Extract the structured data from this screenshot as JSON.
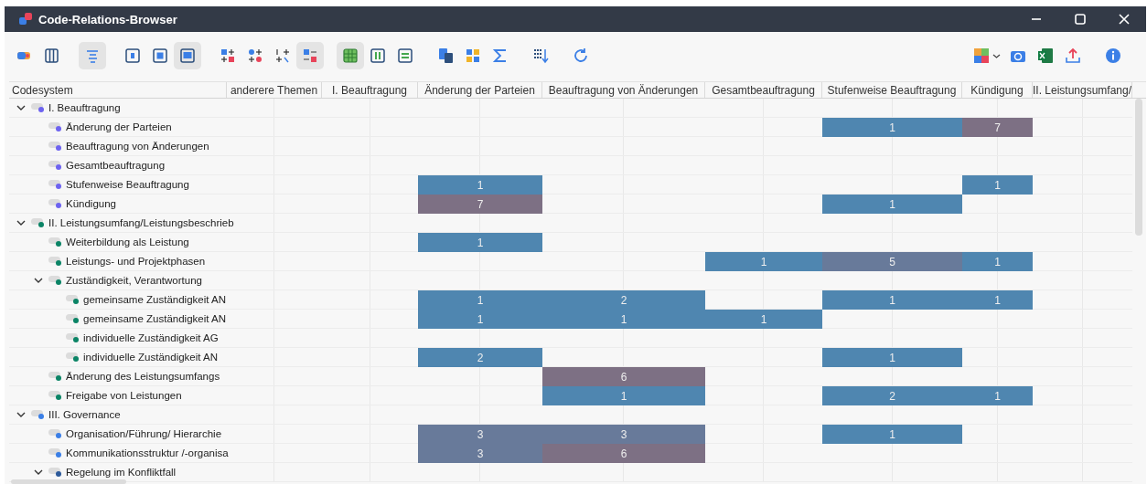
{
  "window": {
    "title": "Code-Relations-Browser"
  },
  "toolbar": {
    "left_groups": [
      {
        "items": [
          {
            "kind": "tag",
            "selected": false
          },
          {
            "kind": "columns",
            "selected": false
          }
        ]
      },
      {
        "items": [
          {
            "kind": "align",
            "selected": true
          }
        ]
      },
      {
        "items": [
          {
            "kind": "framesmall",
            "selected": false
          },
          {
            "kind": "framemid",
            "selected": false
          },
          {
            "kind": "framefull",
            "selected": true
          }
        ]
      },
      {
        "items": [
          {
            "kind": "squares",
            "selected": false
          },
          {
            "kind": "dots",
            "selected": false
          },
          {
            "kind": "numbers",
            "selected": false
          },
          {
            "kind": "mixed",
            "selected": true
          }
        ]
      },
      {
        "items": [
          {
            "kind": "table",
            "selected": true
          },
          {
            "kind": "pause",
            "selected": false
          },
          {
            "kind": "rows",
            "selected": false
          }
        ]
      },
      {
        "items": [
          {
            "kind": "docs",
            "selected": false
          },
          {
            "kind": "tiles",
            "selected": false
          },
          {
            "kind": "sigma",
            "selected": false
          }
        ]
      },
      {
        "items": [
          {
            "kind": "sort",
            "selected": false
          }
        ]
      },
      {
        "items": [
          {
            "kind": "refresh",
            "selected": false
          }
        ]
      }
    ],
    "right_items": [
      {
        "kind": "puzzle",
        "selected": false
      },
      {
        "kind": "camera",
        "selected": false
      },
      {
        "kind": "excel",
        "selected": false
      },
      {
        "kind": "export",
        "selected": false
      },
      {
        "kind": "info",
        "selected": false
      }
    ]
  },
  "table": {
    "columns": [
      "Codesystem",
      "anderere Themen",
      "I. Beauftragung",
      "Änderung der Parteien",
      "Beauftragung von Änderungen",
      "Gesamtbeauftragung",
      "Stufenweise Beauftragung",
      "Kündigung",
      "II. Leistungsumfang/"
    ],
    "rows": [
      {
        "label": "I. Beauftragung",
        "color": "#6d63f0",
        "expanded": true,
        "cells": [
          null,
          null,
          null,
          null,
          null,
          null,
          null,
          null
        ],
        "children": [
          {
            "label": "Änderung der Parteien",
            "color": "#6d63f0",
            "cells": [
              null,
              null,
              null,
              null,
              null,
              {
                "value": "1",
                "color": "#4f86b0"
              },
              {
                "value": "7",
                "color": "#7d7084"
              },
              null
            ]
          },
          {
            "label": "Beauftragung von Änderungen",
            "color": "#6d63f0",
            "cells": [
              null,
              null,
              null,
              null,
              null,
              null,
              null,
              null
            ]
          },
          {
            "label": "Gesamtbeauftragung",
            "color": "#6d63f0",
            "cells": [
              null,
              null,
              null,
              null,
              null,
              null,
              null,
              null
            ]
          },
          {
            "label": "Stufenweise Beauftragung",
            "color": "#6d63f0",
            "cells": [
              null,
              null,
              {
                "value": "1",
                "color": "#4f86b0"
              },
              null,
              null,
              null,
              {
                "value": "1",
                "color": "#4f86b0"
              },
              null
            ]
          },
          {
            "label": "Kündigung",
            "color": "#6d63f0",
            "cells": [
              null,
              null,
              {
                "value": "7",
                "color": "#7d7084"
              },
              null,
              null,
              {
                "value": "1",
                "color": "#4f86b0"
              },
              null,
              null
            ]
          }
        ]
      },
      {
        "label": "II. Leistungsumfang/Leistungsbeschrieb",
        "color": "#0b8466",
        "expanded": true,
        "cells": [
          null,
          null,
          null,
          null,
          null,
          null,
          null,
          null
        ],
        "children": [
          {
            "label": "Weiterbildung als Leistung",
            "color": "#0b8466",
            "cells": [
              null,
              null,
              {
                "value": "1",
                "color": "#4f86b0"
              },
              null,
              null,
              null,
              null,
              null
            ]
          },
          {
            "label": "Leistungs- und Projektphasen",
            "color": "#0b8466",
            "cells": [
              null,
              null,
              null,
              null,
              {
                "value": "1",
                "color": "#4f86b0"
              },
              {
                "value": "5",
                "color": "#687a9a"
              },
              {
                "value": "1",
                "color": "#4f86b0"
              },
              null
            ]
          },
          {
            "label": "Zuständigkeit, Verantwortung",
            "color": "#0b8466",
            "expanded": true,
            "cells": [
              null,
              null,
              null,
              null,
              null,
              null,
              null,
              null
            ],
            "children": [
              {
                "label": "gemeinsame Zuständigkeit AN",
                "color": "#0b8466",
                "cells": [
                  null,
                  null,
                  {
                    "value": "1",
                    "color": "#4f86b0"
                  },
                  {
                    "value": "2",
                    "color": "#4f86b0"
                  },
                  null,
                  {
                    "value": "1",
                    "color": "#4f86b0"
                  },
                  {
                    "value": "1",
                    "color": "#4f86b0"
                  },
                  null
                ]
              },
              {
                "label": "gemeinsame Zuständigkeit AN",
                "color": "#0b8466",
                "cells": [
                  null,
                  null,
                  {
                    "value": "1",
                    "color": "#4f86b0"
                  },
                  {
                    "value": "1",
                    "color": "#4f86b0"
                  },
                  {
                    "value": "1",
                    "color": "#4f86b0"
                  },
                  null,
                  null,
                  null
                ]
              },
              {
                "label": "individuelle Zuständigkeit AG",
                "color": "#0b8466",
                "cells": [
                  null,
                  null,
                  null,
                  null,
                  null,
                  null,
                  null,
                  null
                ]
              },
              {
                "label": "individuelle Zuständigkeit AN",
                "color": "#0b8466",
                "cells": [
                  null,
                  null,
                  {
                    "value": "2",
                    "color": "#4f86b0"
                  },
                  null,
                  null,
                  {
                    "value": "1",
                    "color": "#4f86b0"
                  },
                  null,
                  null
                ]
              }
            ]
          },
          {
            "label": "Änderung des Leistungsumfangs",
            "color": "#0b8466",
            "cells": [
              null,
              null,
              null,
              {
                "value": "6",
                "color": "#7d7084"
              },
              null,
              null,
              null,
              null
            ]
          },
          {
            "label": "Freigabe von Leistungen",
            "color": "#0b8466",
            "cells": [
              null,
              null,
              null,
              {
                "value": "1",
                "color": "#4f86b0"
              },
              null,
              {
                "value": "2",
                "color": "#4f86b0"
              },
              {
                "value": "1",
                "color": "#4f86b0"
              },
              null
            ]
          }
        ]
      },
      {
        "label": "III. Governance",
        "color": "#3b7fe6",
        "expanded": true,
        "cells": [
          null,
          null,
          null,
          null,
          null,
          null,
          null,
          null
        ],
        "children": [
          {
            "label": "Organisation/Führung/ Hierarchie",
            "color": "#3b7fe6",
            "cells": [
              null,
              null,
              {
                "value": "3",
                "color": "#687a9a"
              },
              {
                "value": "3",
                "color": "#687a9a"
              },
              null,
              {
                "value": "1",
                "color": "#4f86b0"
              },
              null,
              null
            ]
          },
          {
            "label": "Kommunikationsstruktur /-organisa",
            "color": "#3b7fe6",
            "cells": [
              null,
              null,
              {
                "value": "3",
                "color": "#687a9a"
              },
              {
                "value": "6",
                "color": "#7d7084"
              },
              null,
              null,
              null,
              null
            ]
          },
          {
            "label": "Regelung im Konfliktfall",
            "color": "#2d5a9a",
            "expanded": true,
            "cells": [
              null,
              null,
              null,
              null,
              null,
              null,
              null,
              null
            ]
          }
        ]
      }
    ]
  }
}
